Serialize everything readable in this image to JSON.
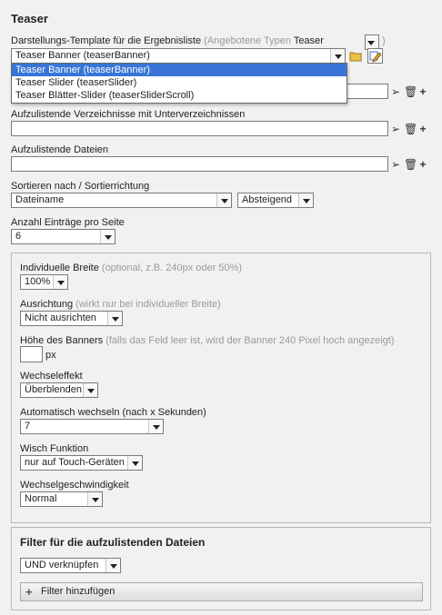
{
  "title": "Teaser",
  "template": {
    "label": "Darstellungs-Template für die Ergebnisliste",
    "hint_open": "(Angebotene Typen",
    "hint_type": "Teaser",
    "hint_close": ")",
    "value": "Teaser Banner (teaserBanner)",
    "options": [
      "Teaser Banner (teaserBanner)",
      "Teaser Slider (teaserSlider)",
      "Teaser Blätter-Slider (teaserSliderScroll)"
    ]
  },
  "dirs_label": "Aufzulistende Verzeichnisse mit Unterverzeichnissen",
  "files_label": "Aufzulistende Dateien",
  "sort": {
    "label": "Sortieren nach / Sortierrichtung",
    "field": "Dateiname",
    "direction": "Absteigend"
  },
  "per_page": {
    "label": "Anzahl Einträge pro Seite",
    "value": "6"
  },
  "settings": {
    "width_label": "Individuelle Breite",
    "width_hint": "(optional, z.B. 240px oder 50%)",
    "width_value": "100%",
    "align_label": "Ausrichtung",
    "align_hint": "(wirkt nur bei individueller Breite)",
    "align_value": "Nicht ausrichten",
    "height_label": "Höhe des Banners",
    "height_hint": "(falls das Feld leer ist, wird der Banner 240 Pixel hoch angezeigt)",
    "height_unit": "px",
    "effect_label": "Wechseleffekt",
    "effect_value": "Überblenden",
    "auto_label": "Automatisch wechseln (nach x Sekunden)",
    "auto_value": "7",
    "swipe_label": "Wisch Funktion",
    "swipe_value": "nur auf Touch-Geräten",
    "speed_label": "Wechselgeschwindigkeit",
    "speed_value": "Normal"
  },
  "filter": {
    "title": "Filter für die aufzulistenden Dateien",
    "mode": "UND verknüpfen",
    "add_label": "Filter hinzufügen"
  }
}
